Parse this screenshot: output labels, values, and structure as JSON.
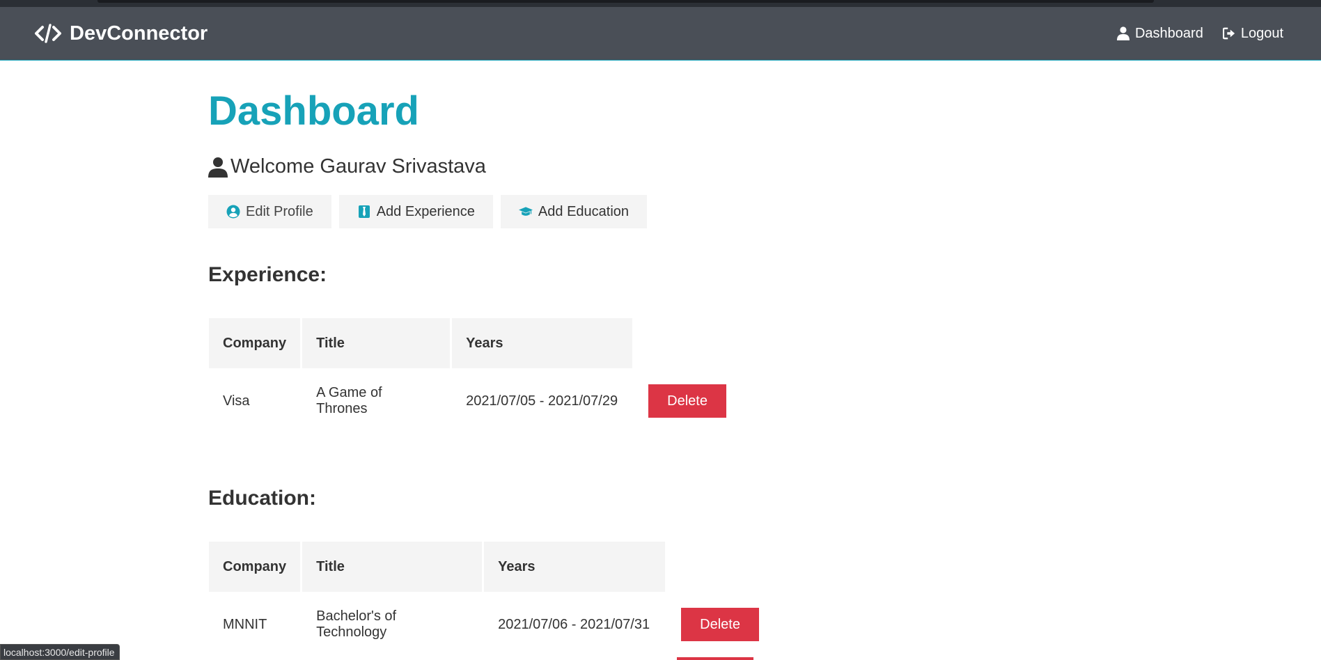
{
  "navbar": {
    "brand": "DevConnector",
    "links": [
      {
        "label": "Dashboard",
        "icon": "user-icon"
      },
      {
        "label": "Logout",
        "icon": "sign-out-icon"
      }
    ]
  },
  "main": {
    "title": "Dashboard",
    "welcome": "Welcome Gaurav Srivastava",
    "buttons": [
      {
        "label": "Edit Profile",
        "icon": "user-circle-icon"
      },
      {
        "label": "Add Experience",
        "icon": "briefcase-icon"
      },
      {
        "label": "Add Education",
        "icon": "graduation-cap-icon"
      }
    ]
  },
  "experience": {
    "heading": "Experience:",
    "columns": [
      "Company",
      "Title",
      "Years"
    ],
    "rows": [
      {
        "company": "Visa",
        "title": "A Game of Thrones",
        "years": "2021/07/05 - 2021/07/29",
        "action": "Delete"
      }
    ]
  },
  "education": {
    "heading": "Education:",
    "columns": [
      "Company",
      "Title",
      "Years"
    ],
    "rows": [
      {
        "company": "MNNIT",
        "title": "Bachelor's of Technology",
        "years": "2021/07/06 - 2021/07/31",
        "action": "Delete"
      }
    ]
  },
  "status_bar": {
    "url": "localhost:3000/edit-profile"
  },
  "colors": {
    "primary": "#17a2b8",
    "dark": "#4a4f57",
    "danger": "#dc3545",
    "light": "#f4f4f4"
  }
}
